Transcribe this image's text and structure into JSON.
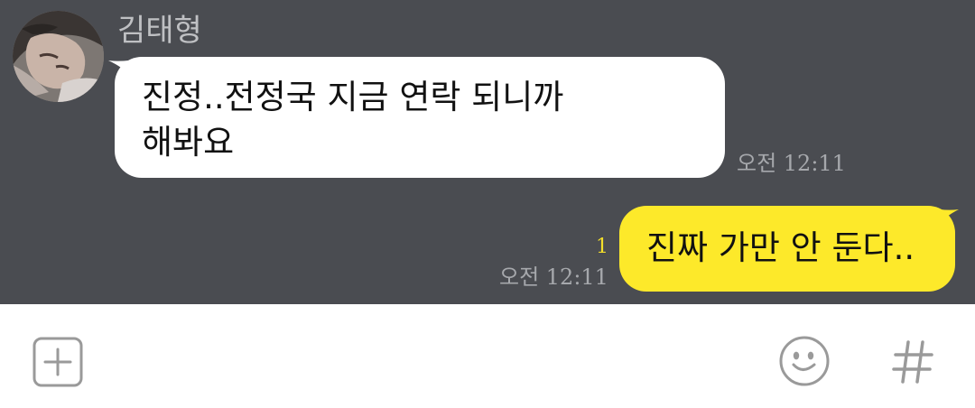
{
  "chat": {
    "sender_name": "김태형",
    "incoming": {
      "text": "진정..전정국 지금 연락 되니까\n해봐요",
      "time": "오전 12:11"
    },
    "outgoing": {
      "text": "진짜 가만 안 둔다..",
      "time": "오전 12:11",
      "unread_count": "1"
    }
  },
  "input_bar": {
    "icons": [
      "plus-icon",
      "emoji-icon",
      "hash-icon"
    ]
  },
  "colors": {
    "chat_background": "#4a4c51",
    "incoming_bubble": "#ffffff",
    "outgoing_bubble": "#fde92a",
    "unread": "#f3de2a",
    "timestamp": "#a6a8ac",
    "icon": "#9a9a9a"
  }
}
